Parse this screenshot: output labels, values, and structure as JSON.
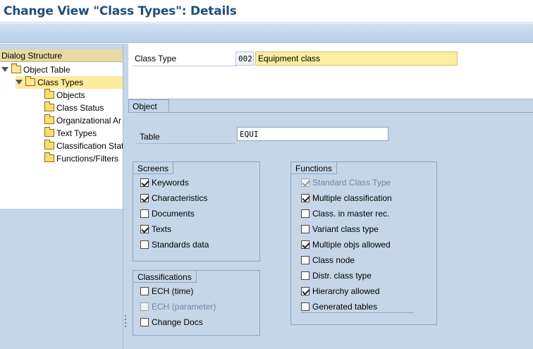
{
  "title": "Change View \"Class Types\": Details",
  "dialog_structure": {
    "header": "Dialog Structure",
    "items": [
      {
        "label": "Object Table",
        "level": 0,
        "expanded": true,
        "selected": false
      },
      {
        "label": "Class Types",
        "level": 1,
        "expanded": true,
        "selected": true
      },
      {
        "label": "Objects",
        "level": 2
      },
      {
        "label": "Class Status",
        "level": 2
      },
      {
        "label": "Organizational Ar",
        "level": 2
      },
      {
        "label": "Text Types",
        "level": 2
      },
      {
        "label": "Classification Stat",
        "level": 2
      },
      {
        "label": "Functions/Filters",
        "level": 2
      }
    ]
  },
  "class_type": {
    "label": "Class Type",
    "code": "002",
    "name": "Equipment class"
  },
  "object": {
    "tab": "Object",
    "table_label": "Table",
    "table_value": "EQUI"
  },
  "screens": {
    "title": "Screens",
    "items": [
      {
        "label": "Keywords",
        "checked": true
      },
      {
        "label": "Characteristics",
        "checked": true
      },
      {
        "label": "Documents",
        "checked": false
      },
      {
        "label": "Texts",
        "checked": true
      },
      {
        "label": "Standards data",
        "checked": false
      }
    ]
  },
  "classifications": {
    "title": "Classifications",
    "items": [
      {
        "label": "ECH (time)",
        "checked": false,
        "disabled": false
      },
      {
        "label": "ECH (parameter)",
        "checked": false,
        "disabled": true
      },
      {
        "label": "Change Docs",
        "checked": false,
        "disabled": false
      }
    ]
  },
  "functions": {
    "title": "Functions",
    "items": [
      {
        "label": "Standard Class Type",
        "checked": true,
        "disabled": true
      },
      {
        "label": "Multiple classification",
        "checked": true,
        "disabled": false
      },
      {
        "label": "Class. in master rec.",
        "checked": false,
        "disabled": false
      },
      {
        "label": "Variant class type",
        "checked": false,
        "disabled": false
      },
      {
        "label": "Multiple objs allowed",
        "checked": true,
        "disabled": false
      },
      {
        "label": "Class node",
        "checked": false,
        "disabled": false
      },
      {
        "label": "Distr. class type",
        "checked": false,
        "disabled": false
      },
      {
        "label": "Hierarchy allowed",
        "checked": true,
        "disabled": false
      },
      {
        "label": "Generated tables",
        "checked": false,
        "disabled": false
      }
    ]
  },
  "colors": {
    "title": "#1f4e79",
    "panel": "#c4d6e8",
    "selection": "#ffeb9c",
    "input_highlight": "#fbeea0"
  }
}
